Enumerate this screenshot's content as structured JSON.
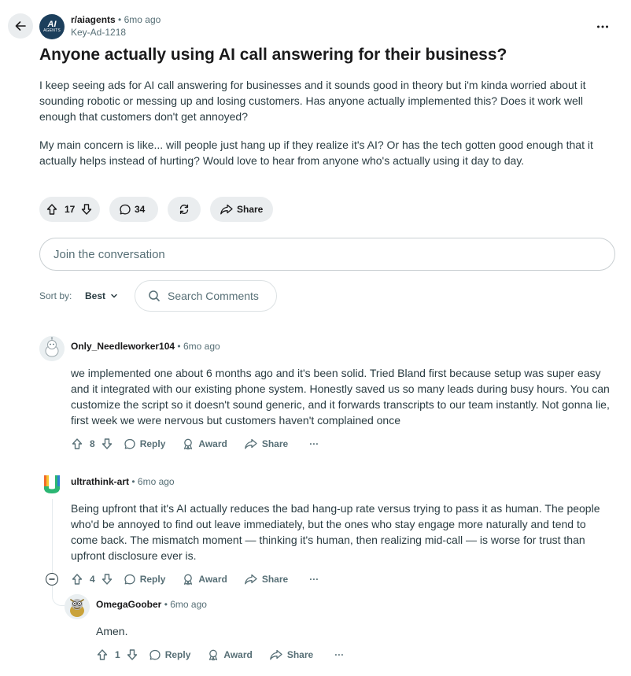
{
  "post": {
    "subreddit": "r/aiagents",
    "time": "6mo ago",
    "author": "Key-Ad-1218",
    "avatar_text_1": "AI",
    "avatar_text_2": "AGENTS",
    "title": "Anyone actually using AI call answering for their business?",
    "paragraphs": [
      "I keep seeing ads for AI call answering for businesses and it sounds good in theory but i'm kinda worried about it sounding robotic or messing up and losing customers. Has anyone actually implemented this? Does it work well enough that customers don't get annoyed?",
      "My main concern is like... will people just hang up if they realize it's AI? Or has the tech gotten good enough that it actually helps instead of hurting? Would love to hear from anyone who's actually using it day to day."
    ],
    "votes": "17",
    "comments": "34",
    "share_label": "Share"
  },
  "composer": {
    "placeholder": "Join the conversation"
  },
  "sort": {
    "label": "Sort by:",
    "value": "Best"
  },
  "search": {
    "placeholder": "Search Comments"
  },
  "comments": [
    {
      "user": "Only_Needleworker104",
      "time": "6mo ago",
      "text": "we implemented one about 6 months ago and it's been solid. Tried Bland first because setup was super easy and it integrated with our existing phone system. Honestly saved us so many leads during busy hours. You can customize the script so it doesn't sound generic, and it forwards transcripts to our team instantly. Not gonna lie, first week we were nervous but customers haven't complained once",
      "votes": "8"
    },
    {
      "user": "ultrathink-art",
      "time": "6mo ago",
      "text": "Being upfront that it's AI actually reduces the bad hang-up rate versus trying to pass it as human. The people who'd be annoyed to find out leave immediately, but the ones who stay engage more naturally and tend to come back. The mismatch moment — thinking it's human, then realizing mid-call — is worse for trust than upfront disclosure ever is.",
      "votes": "4"
    },
    {
      "user": "OmegaGoober",
      "time": "6mo ago",
      "text": "Amen.",
      "votes": "1"
    }
  ],
  "actions": {
    "reply": "Reply",
    "award": "Award",
    "share": "Share",
    "more": "···"
  },
  "separator": "•",
  "icons": {
    "back": "arrow-left-icon",
    "more": "ellipsis-icon",
    "upvote": "arrow-up-icon",
    "downvote": "arrow-down-icon",
    "comment": "comment-icon",
    "crosspost": "crosspost-icon",
    "share": "share-icon",
    "search": "search-icon",
    "award": "award-icon",
    "chevron": "chevron-down-icon"
  },
  "colors": {
    "pill_bg": "#eaedef",
    "meta": "#576f76",
    "text": "#2a3c42",
    "avatar_bg": "#1c3f5c"
  }
}
